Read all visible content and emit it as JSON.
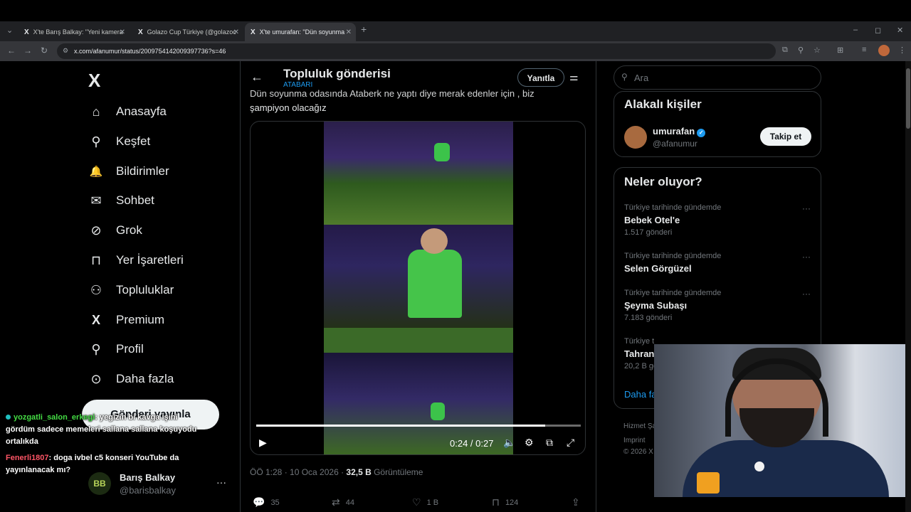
{
  "browser": {
    "tabs": [
      {
        "title": "X'te Barış Balkay: \"Yeni kamera",
        "active": false
      },
      {
        "title": "Golazo Cup Türkiye (@golazoc",
        "active": false
      },
      {
        "title": "X'te umurafan: \"Dün soyunma",
        "active": true
      }
    ],
    "new_tab": "+",
    "url": "x.com/afanumur/status/2009754142009397736?s=46",
    "window_controls": [
      "–",
      "◻",
      "✕"
    ]
  },
  "sidebar": {
    "logo": "X",
    "items": [
      {
        "label": "Anasayfa",
        "icon": "home-icon",
        "glyph": "⌂"
      },
      {
        "label": "Keşfet",
        "icon": "search-icon",
        "glyph": "⚲"
      },
      {
        "label": "Bildirimler",
        "icon": "bell-icon",
        "glyph": "🔔"
      },
      {
        "label": "Sohbet",
        "icon": "mail-icon",
        "glyph": "✉"
      },
      {
        "label": "Grok",
        "icon": "grok-icon",
        "glyph": "⊘"
      },
      {
        "label": "Yer İşaretleri",
        "icon": "bookmark-icon",
        "glyph": "⊓"
      },
      {
        "label": "Topluluklar",
        "icon": "communities-icon",
        "glyph": "⚇"
      },
      {
        "label": "Premium",
        "icon": "x-premium-icon",
        "glyph": "X"
      },
      {
        "label": "Profil",
        "icon": "profile-icon",
        "glyph": "⚲"
      },
      {
        "label": "Daha fazla",
        "icon": "more-circle-icon",
        "glyph": "⊙"
      }
    ],
    "post_button": "Gönderi yayınla",
    "account": {
      "initials": "BB",
      "name": "Barış Balkay",
      "handle": "@barisbalkay",
      "more": "···"
    }
  },
  "main": {
    "title": "Topluluk gönderisi",
    "community": "ATABARI",
    "reply_button": "Yanıtla",
    "post_text_line1": "Dün soyunma odasında Ataberk ne yaptı diye merak edenler için , biz",
    "post_text_line2": "şampiyon olacağız",
    "video": {
      "current": "0:24",
      "total": "0:27",
      "time_display": "0:24 / 0:27",
      "progress": 0.89
    },
    "meta": {
      "time": "ÖÖ 1:28 · 10 Oca 2026 · ",
      "views": "32,5 B",
      "views_label": " Görüntüleme"
    },
    "actions": {
      "replies": "35",
      "reposts": "44",
      "likes": "1 B",
      "bookmarks": "124"
    }
  },
  "right": {
    "search_placeholder": "Ara",
    "related_title": "Alakalı kişiler",
    "person": {
      "name": "umurafan",
      "handle": "@afanumur",
      "follow": "Takip et"
    },
    "trends_title": "Neler oluyor?",
    "trends": [
      {
        "context": "Türkiye tarihinde gündemde",
        "topic": "Bebek Otel'e",
        "count": "1.517 gönderi"
      },
      {
        "context": "Türkiye tarihinde gündemde",
        "topic": "Selen Görgüzel",
        "count": ""
      },
      {
        "context": "Türkiye tarihinde gündemde",
        "topic": "Şeyma Subaşı",
        "count": "7.183 gönderi"
      },
      {
        "context": "Türkiye t",
        "topic": "Tahran",
        "count": "20,2 B gö"
      }
    ],
    "show_more": "Daha fa",
    "footer": [
      "Hizmet Şa",
      "Imprint",
      "© 2026 X"
    ]
  },
  "stream_chat": [
    {
      "user": "yozgatli_salon_erkegi",
      "text": ": yegizin bi kavga işini gördüm sadece memeleri sallana sallana koşuyodu ortalıkda"
    },
    {
      "user": "Fenerli1807",
      "text": ": doga ivbel c5 konseri YouTube da yayınlanacak mı?"
    }
  ],
  "colors": {
    "accent": "#1d9bf0",
    "bg": "#000000",
    "border": "#2f3336",
    "muted": "#71767b"
  }
}
